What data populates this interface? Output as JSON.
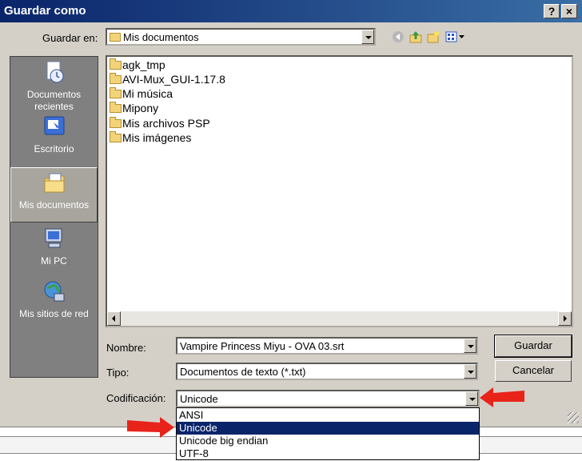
{
  "window": {
    "title": "Guardar como",
    "help_btn": "?",
    "close_btn": "×"
  },
  "toolbar": {
    "save_in_label": "Guardar en:",
    "save_in_value": "Mis documentos",
    "icons": [
      "back-icon",
      "up-folder-icon",
      "new-folder-icon",
      "view-menu-icon"
    ]
  },
  "places": [
    {
      "label": "Documentos recientes",
      "icon": "recent-documents-icon"
    },
    {
      "label": "Escritorio",
      "icon": "desktop-icon"
    },
    {
      "label": "Mis documentos",
      "icon": "my-documents-icon",
      "selected": true
    },
    {
      "label": "Mi PC",
      "icon": "my-computer-icon"
    },
    {
      "label": "Mis sitios de red",
      "icon": "network-places-icon"
    }
  ],
  "files": [
    "agk_tmp",
    "AVI-Mux_GUI-1.17.8",
    "Mi música",
    "Mipony",
    "Mis archivos PSP",
    "Mis imágenes"
  ],
  "form": {
    "name_label": "Nombre:",
    "name_value": "Vampire Princess Miyu - OVA 03.srt",
    "type_label": "Tipo:",
    "type_value": "Documentos de texto (*.txt)",
    "encoding_label": "Codificación:",
    "encoding_value": "Unicode"
  },
  "buttons": {
    "save": "Guardar",
    "cancel": "Cancelar"
  },
  "encoding_options": [
    {
      "label": "ANSI"
    },
    {
      "label": "Unicode",
      "selected": true
    },
    {
      "label": "Unicode big endian"
    },
    {
      "label": "UTF-8"
    }
  ],
  "colors": {
    "titlebar": "#0a246a",
    "selection": "#0a246a",
    "annotation_arrow": "#e8231a"
  }
}
